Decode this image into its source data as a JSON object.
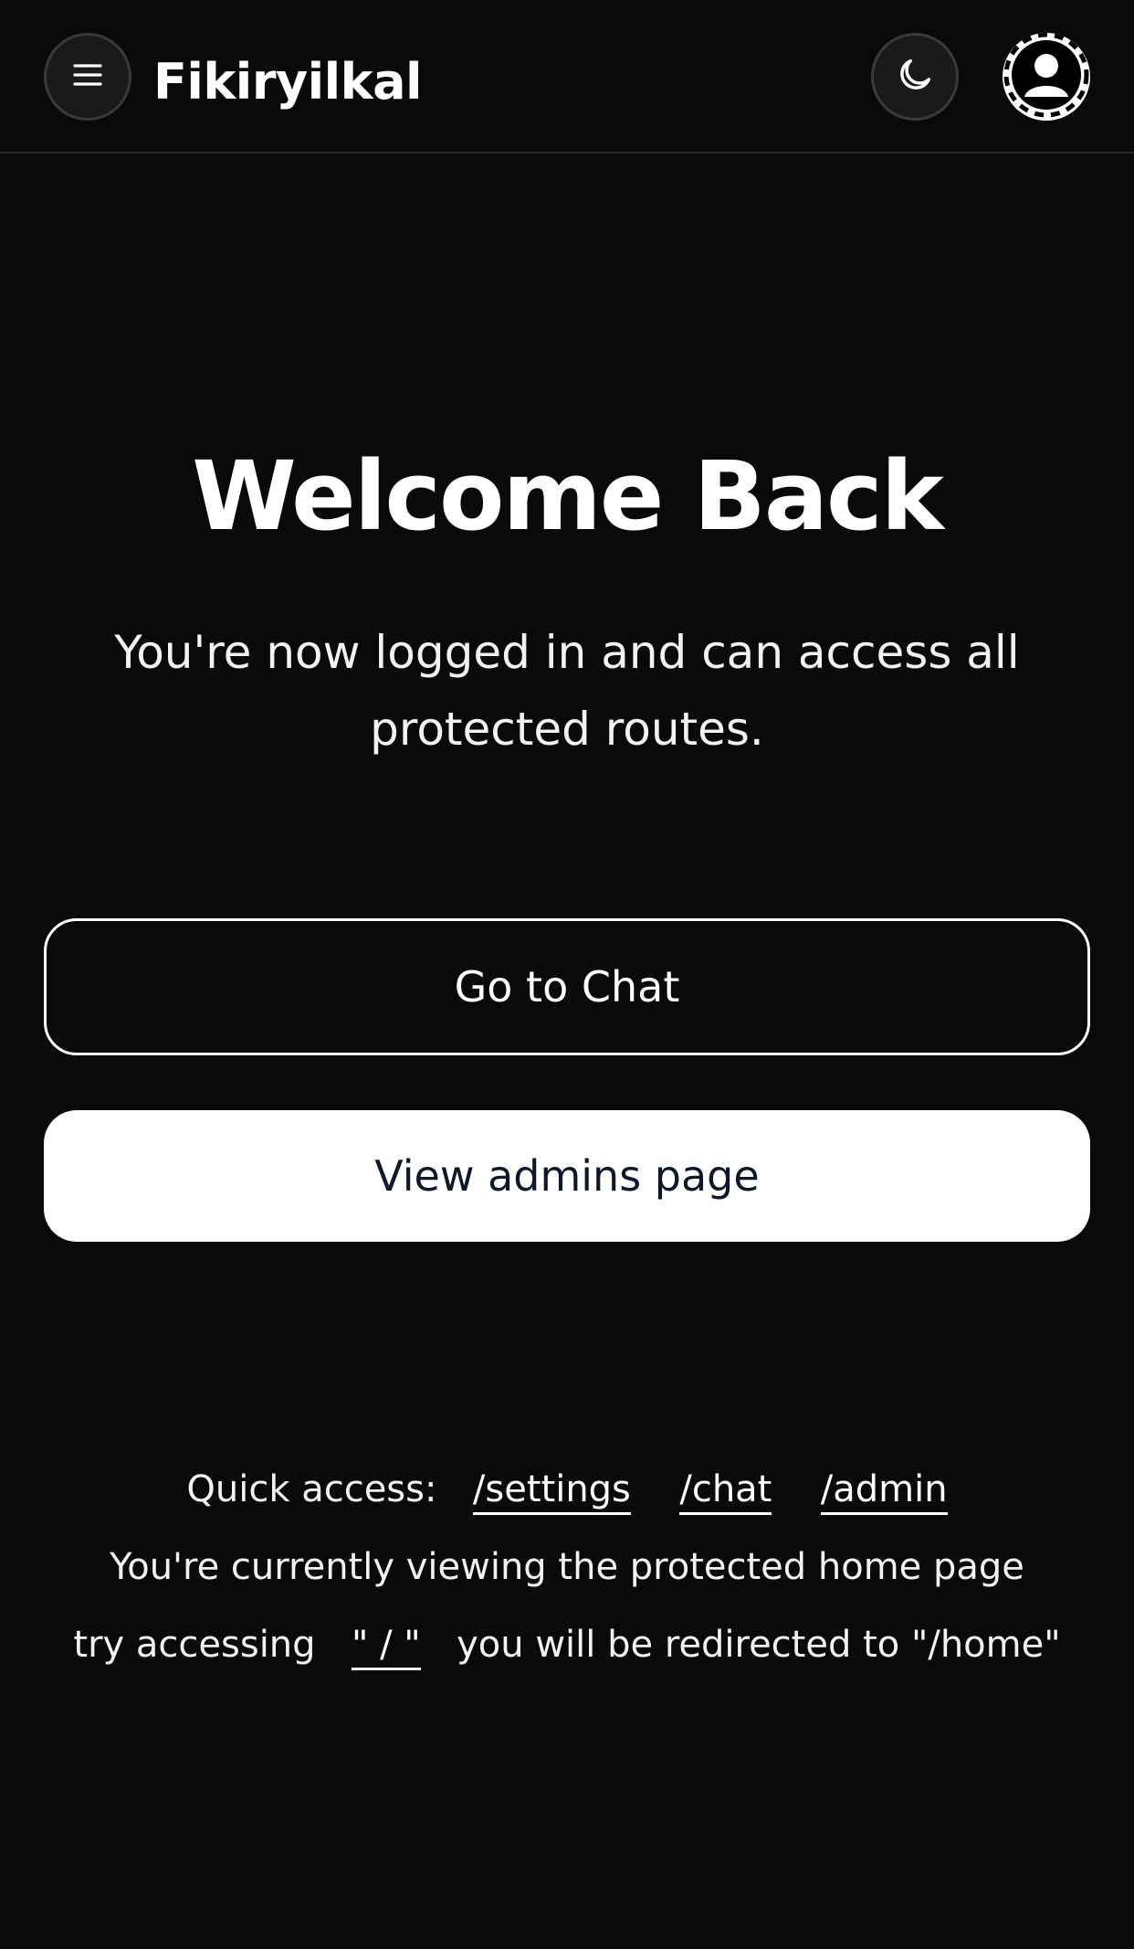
{
  "header": {
    "brand": "Fikiryilkal",
    "menu_icon": "hamburger-icon",
    "theme_icon": "moon-icon",
    "avatar_icon": "user-avatar-icon"
  },
  "hero": {
    "title": "Welcome Back",
    "subtitle": "You're now logged in and can access all protected routes."
  },
  "actions": {
    "chat_label": "Go to Chat",
    "admin_label": "View admins page"
  },
  "footer": {
    "quick_access_label": "Quick access:",
    "links": [
      "/settings",
      "/chat",
      "/admin"
    ],
    "info_text": "You're currently viewing the protected home page",
    "try_prefix": "try accessing",
    "root_link": "\" / \"",
    "try_suffix": "you will be redirected to \"/home\""
  },
  "colors": {
    "background": "#0a0a0a",
    "text": "#ffffff",
    "solid_button_text": "#0f172a"
  }
}
